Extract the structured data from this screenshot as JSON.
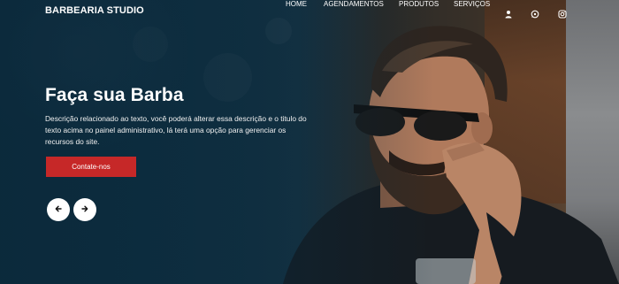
{
  "header": {
    "logo": "BARBEARIA STUDIO",
    "nav": [
      {
        "label": "HOME"
      },
      {
        "label": "AGENDAMENTOS"
      },
      {
        "label": "PRODUTOS"
      },
      {
        "label": "SERVIÇOS"
      }
    ],
    "icons": [
      "user-icon",
      "whatsapp-icon",
      "instagram-icon"
    ]
  },
  "hero": {
    "title": "Faça sua Barba",
    "description": "Descrição relacionado ao texto, você poderá alterar essa descrição e o titulo do texto acima no painel administrativo, lá terá uma opção para gerenciar os recursos do site.",
    "cta_label": "Contate-nos",
    "carousel": {
      "prev_icon": "arrow-left-icon",
      "next_icon": "arrow-right-icon"
    }
  },
  "colors": {
    "accent": "#c62828",
    "overlay": "#0a283a",
    "text": "#ffffff"
  }
}
